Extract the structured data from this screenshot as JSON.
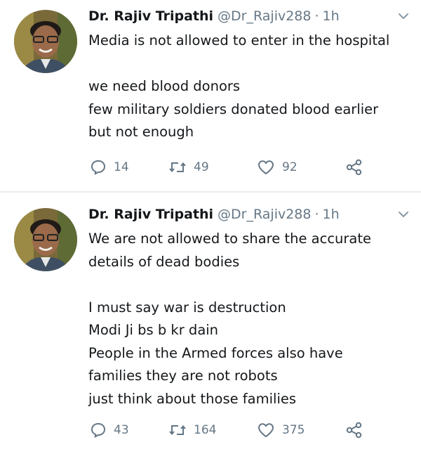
{
  "tweets": [
    {
      "author_name": "Dr. Rajiv Tripathi",
      "handle": "@Dr_Rajiv288",
      "time": "1h",
      "lines": [
        "Media is not allowed to enter in the hospital",
        "",
        "we need blood donors",
        "few military soldiers donated blood earlier",
        "but not enough"
      ],
      "replies": "14",
      "retweets": "49",
      "likes": "92"
    },
    {
      "author_name": "Dr. Rajiv Tripathi",
      "handle": "@Dr_Rajiv288",
      "time": "1h",
      "lines": [
        "We are not allowed to share the accurate",
        "details of dead bodies",
        "",
        "I must say war is destruction",
        "Modi Ji bs b kr dain",
        "People in the Armed forces also have",
        "families they are not robots",
        "just think about those families"
      ],
      "replies": "43",
      "retweets": "164",
      "likes": "375"
    }
  ],
  "icons": {
    "reply": "reply-icon",
    "retweet": "retweet-icon",
    "like": "heart-icon",
    "share": "share-icon",
    "caret": "chevron-down-icon"
  },
  "colors": {
    "text": "#14171a",
    "muted": "#657786",
    "divider": "#e6ecf0"
  }
}
